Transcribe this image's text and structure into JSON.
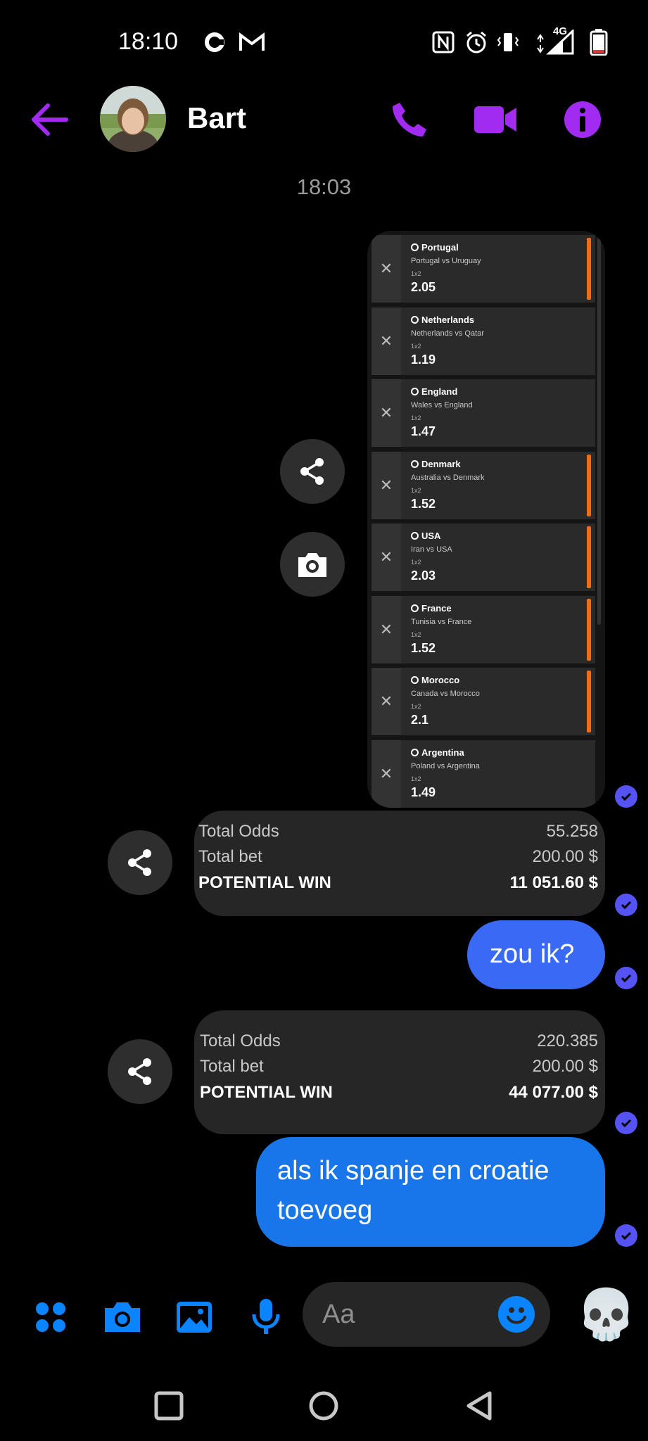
{
  "status_bar": {
    "time": "18:10",
    "network_label": "4G",
    "icons": [
      "sync-icon",
      "gmail-icon",
      "nfc-icon",
      "alarm-icon",
      "vibrate-icon",
      "signal-icon",
      "battery-icon"
    ]
  },
  "header": {
    "contact_name": "Bart",
    "accent_color": "#a12bf0"
  },
  "conversation": {
    "timestamp": "18:03",
    "bet_slip": {
      "bets": [
        {
          "team": "Portugal",
          "match": "Portugal vs Uruguay",
          "market": "1x2",
          "odds": "2.05",
          "highlighted": true
        },
        {
          "team": "Netherlands",
          "match": "Netherlands vs Qatar",
          "market": "1x2",
          "odds": "1.19",
          "highlighted": false
        },
        {
          "team": "England",
          "match": "Wales vs England",
          "market": "1x2",
          "odds": "1.47",
          "highlighted": false
        },
        {
          "team": "Denmark",
          "match": "Australia vs Denmark",
          "market": "1x2",
          "odds": "1.52",
          "highlighted": true
        },
        {
          "team": "USA",
          "match": "Iran vs USA",
          "market": "1x2",
          "odds": "2.03",
          "highlighted": true
        },
        {
          "team": "France",
          "match": "Tunisia vs France",
          "market": "1x2",
          "odds": "1.52",
          "highlighted": true
        },
        {
          "team": "Morocco",
          "match": "Canada vs Morocco",
          "market": "1x2",
          "odds": "2.1",
          "highlighted": true
        },
        {
          "team": "Argentina",
          "match": "Poland vs Argentina",
          "market": "1x2",
          "odds": "1.49",
          "highlighted": false
        }
      ]
    },
    "totals_1": {
      "odds_label": "Total Odds",
      "odds_value": "55.258",
      "bet_label": "Total bet",
      "bet_value": "200.00 $",
      "win_label": "POTENTIAL WIN",
      "win_value": "11 051.60 $"
    },
    "message_1": "zou ik?",
    "totals_2": {
      "odds_label": "Total Odds",
      "odds_value": "220.385",
      "bet_label": "Total bet",
      "bet_value": "200.00 $",
      "win_label": "POTENTIAL WIN",
      "win_value": "44 077.00 $"
    },
    "message_2": "als ik spanje en croatie toevoeg"
  },
  "composer": {
    "placeholder": "Aa",
    "quick_reaction": "💀"
  },
  "colors": {
    "bubble_blue": "#3a6af5",
    "bubble_blue_2": "#1876ea",
    "composer_blue": "#0a84ff",
    "read_check": "#5653f5",
    "slip_orange": "#f26d12"
  }
}
